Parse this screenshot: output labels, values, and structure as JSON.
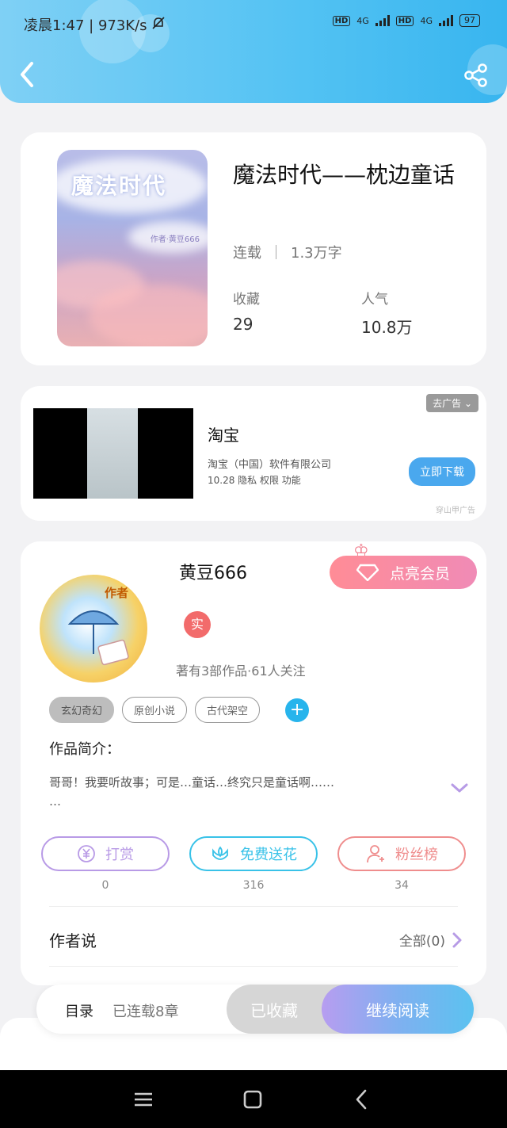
{
  "status_bar": {
    "time": "凌晨1:47",
    "speed": "973K/s",
    "hd1": "HD",
    "net1": "4G",
    "hd2": "HD",
    "net2": "4G",
    "battery": "97"
  },
  "book": {
    "title": "魔法时代——枕边童话",
    "status": "连载",
    "words": "1.3万字",
    "stats": [
      {
        "label": "收藏",
        "value": "29"
      },
      {
        "label": "人气",
        "value": "10.8万"
      }
    ],
    "cover_title": "魔法时代",
    "cover_author": "作者·黄豆666"
  },
  "ad": {
    "title": "淘宝",
    "company": "淘宝（中国）软件有限公司",
    "info": "10.28  隐私  权限  功能",
    "remove_label": "去广告",
    "download_label": "立即下载",
    "mark": "穿山甲广告"
  },
  "author": {
    "name": "黄豆666",
    "avatar_tag": "作者",
    "verified_badge": "实",
    "works_info": "著有3部作品·61人关注",
    "vip_label": "点亮会员",
    "tags": [
      "玄幻奇幻",
      "原创小说",
      "古代架空"
    ],
    "intro_heading": "作品简介：",
    "intro_text": "哥哥！我要听故事；可是…童话…终究只是童话啊……\n…",
    "actions": [
      {
        "label": "打赏",
        "count": "0",
        "color": "#b89ae6",
        "icon": "yen-icon"
      },
      {
        "label": "免费送花",
        "count": "316",
        "color": "#39c2e8",
        "icon": "flower-icon"
      },
      {
        "label": "粉丝榜",
        "count": "34",
        "color": "#ef8d8d",
        "icon": "person-icon"
      }
    ],
    "author_say_label": "作者说",
    "author_say_all": "全部(0)"
  },
  "bottom": {
    "toc_label": "目录",
    "toc_sub": "已连载8章",
    "collected_label": "已收藏",
    "read_label": "继续阅读"
  }
}
